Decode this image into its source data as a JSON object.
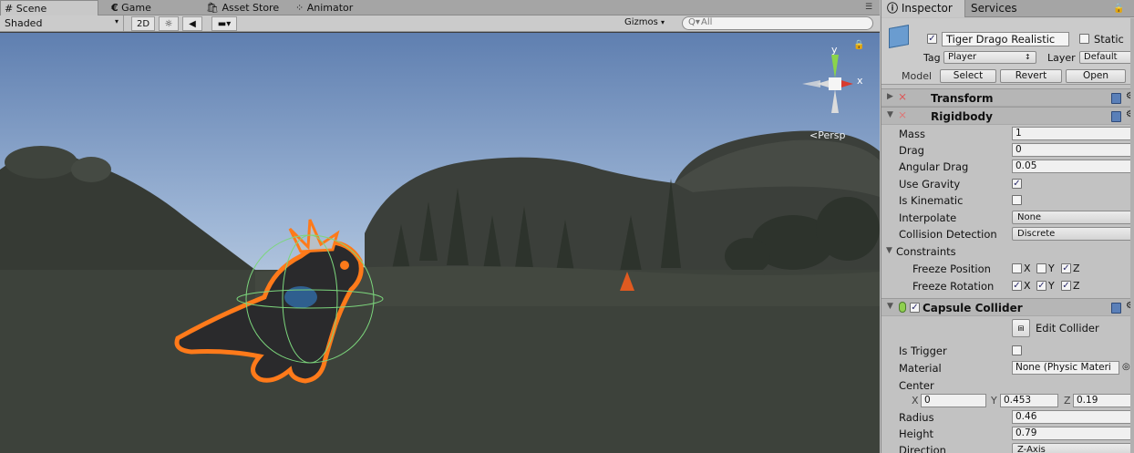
{
  "scene_tabs": {
    "scene": "Scene",
    "game": "Game",
    "asset_store": "Asset Store",
    "animator": "Animator"
  },
  "scene_toolbar": {
    "shading_mode": "Shaded",
    "mode_2d": "2D",
    "gizmos": "Gizmos",
    "search_placeholder": "All"
  },
  "gizmo": {
    "y": "y",
    "x": "x",
    "persp": "Persp"
  },
  "inspector": {
    "tabs": {
      "inspector": "Inspector",
      "services": "Services"
    },
    "object_name": "Tiger Drago Realistic",
    "static_label": "Static",
    "tag_label": "Tag",
    "tag_value": "Player",
    "layer_label": "Layer",
    "layer_value": "Default",
    "model_label": "Model",
    "select_btn": "Select",
    "revert_btn": "Revert",
    "open_btn": "Open",
    "transform_title": "Transform",
    "rigidbody_title": "Rigidbody",
    "rigidbody": {
      "mass_label": "Mass",
      "mass": "1",
      "drag_label": "Drag",
      "drag": "0",
      "angular_drag_label": "Angular Drag",
      "angular_drag": "0.05",
      "use_gravity_label": "Use Gravity",
      "use_gravity": true,
      "is_kinematic_label": "Is Kinematic",
      "is_kinematic": false,
      "interpolate_label": "Interpolate",
      "interpolate": "None",
      "collision_label": "Collision Detection",
      "collision": "Discrete",
      "constraints_label": "Constraints",
      "freeze_position_label": "Freeze Position",
      "freeze_rotation_label": "Freeze Rotation",
      "axis_x": "X",
      "axis_y": "Y",
      "axis_z": "Z",
      "freeze_position": {
        "x": false,
        "y": false,
        "z": true
      },
      "freeze_rotation": {
        "x": true,
        "y": true,
        "z": true
      }
    },
    "capsule_title": "Capsule Collider",
    "capsule": {
      "edit_collider": "Edit Collider",
      "is_trigger_label": "Is Trigger",
      "is_trigger": false,
      "material_label": "Material",
      "material": "None (Physic Materi",
      "center_label": "Center",
      "center_x_label": "X",
      "center_x": "0",
      "center_y_label": "Y",
      "center_y": "0.453",
      "center_z_label": "Z",
      "center_z": "0.19",
      "radius_label": "Radius",
      "radius": "0.46",
      "height_label": "Height",
      "height": "0.79",
      "direction_label": "Direction",
      "direction": "Z-Axis"
    }
  },
  "colors": {
    "selection_outline": "#ff7a1a",
    "collider_wire": "#7cd67c",
    "sky_top": "#6f8fbf",
    "ground": "#3d423b"
  }
}
